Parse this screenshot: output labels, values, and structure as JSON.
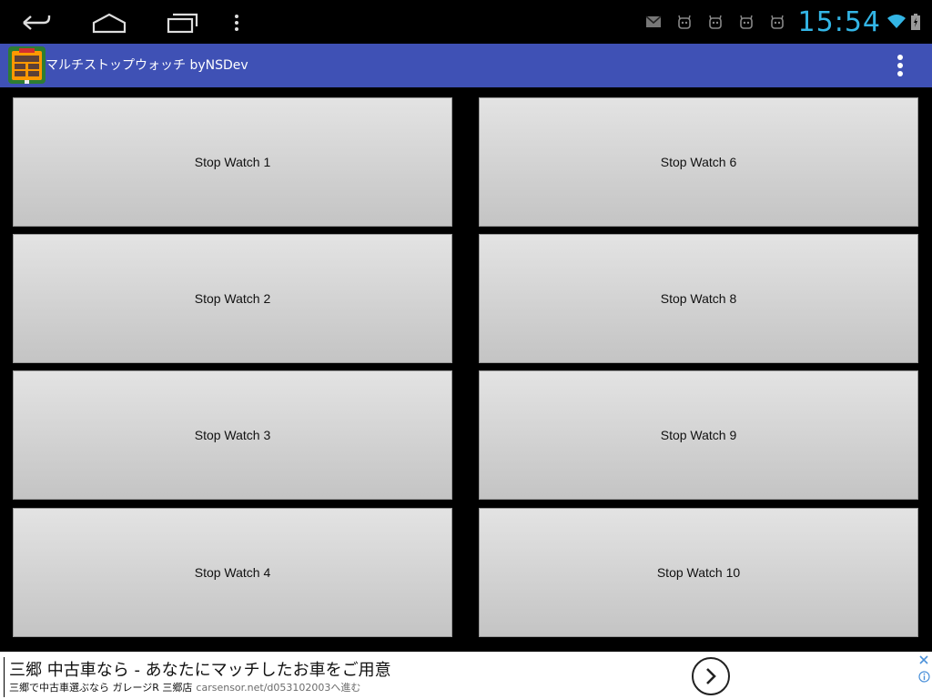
{
  "status_bar": {
    "nav": [
      "back-icon",
      "home-icon",
      "recents-icon",
      "menu-icon"
    ],
    "notifications": [
      "gmail-icon",
      "android-icon",
      "android-icon",
      "android-icon",
      "android-icon"
    ],
    "clock": "15:54",
    "system": [
      "wifi-icon",
      "battery-icon"
    ],
    "accent_color": "#33b5e5"
  },
  "app_bar": {
    "title": "マルチストップウォッチ byNSDev",
    "background": "#3f51b5",
    "overflow_icon": "more-vert-icon"
  },
  "stopwatches": {
    "left": [
      "Stop Watch 1",
      "Stop Watch 2",
      "Stop Watch 3",
      "Stop Watch 4"
    ],
    "right": [
      "Stop Watch 6",
      "Stop Watch 8",
      "Stop Watch 9",
      "Stop Watch 10"
    ]
  },
  "ad": {
    "headline": "三郷 中古車なら - あなたにマッチしたお車をご用意",
    "subtext": "三郷で中古車選ぶなら ガレージR 三郷店",
    "url": "carsensor.net/d053102003へ進む"
  }
}
